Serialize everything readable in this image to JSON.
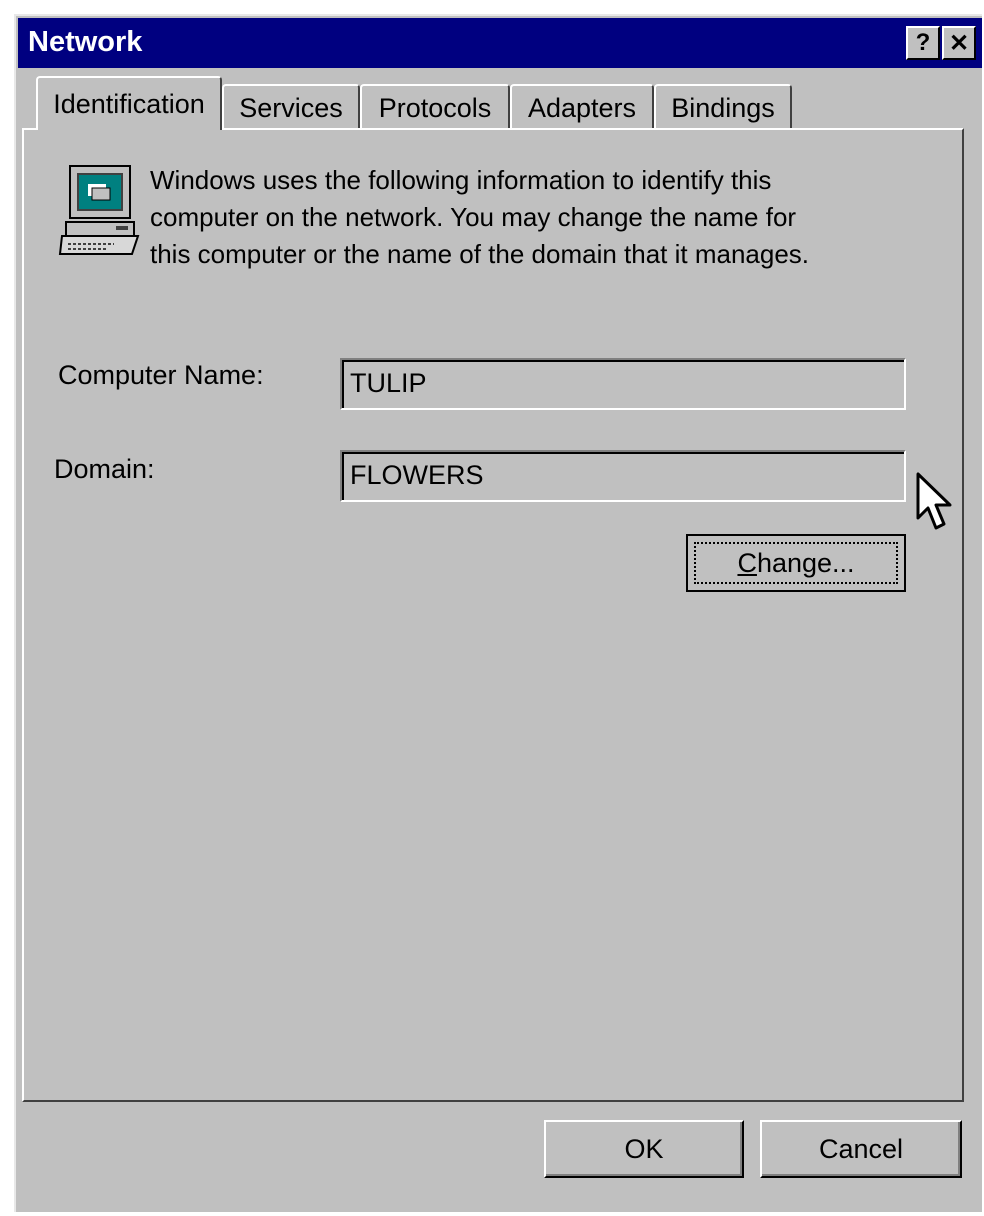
{
  "window": {
    "title": "Network",
    "help_label": "?",
    "close_label": "✕"
  },
  "tabs": [
    {
      "label": "Identification",
      "active": true
    },
    {
      "label": "Services",
      "active": false
    },
    {
      "label": "Protocols",
      "active": false
    },
    {
      "label": "Adapters",
      "active": false
    },
    {
      "label": "Bindings",
      "active": false
    }
  ],
  "identification": {
    "icon": "computer-icon",
    "description": "Windows uses the following information to identify this\ncomputer on the network.  You may change the name for\nthis computer or the name of the domain that it manages.",
    "computer_name_label": "Computer Name:",
    "computer_name_value": "TULIP",
    "domain_label": "Domain:",
    "domain_value": "FLOWERS",
    "change_label_accel": "C",
    "change_label_rest": "hange..."
  },
  "buttons": {
    "ok": "OK",
    "cancel": "Cancel"
  },
  "colors": {
    "title_bar": "#000080",
    "face": "#c0c0c0"
  }
}
